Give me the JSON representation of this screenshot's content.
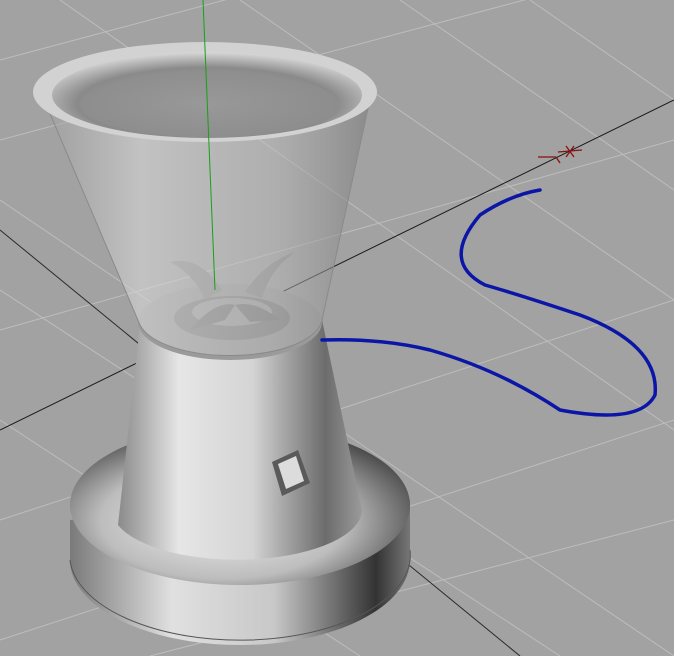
{
  "viewport": {
    "type": "3d-perspective-view",
    "background": "#a2a2a2",
    "grid_color": "#bdbdbd",
    "axis_line_color": "#1a1a1a",
    "vertical_axis_color": "#19a019",
    "cord_color": "#0b16a6",
    "marker_color": "#8a1010",
    "marker_icon": "light-target-icon",
    "objects": [
      "blender-jar",
      "blender-blade",
      "blender-base",
      "power-cord",
      "power-button"
    ]
  }
}
